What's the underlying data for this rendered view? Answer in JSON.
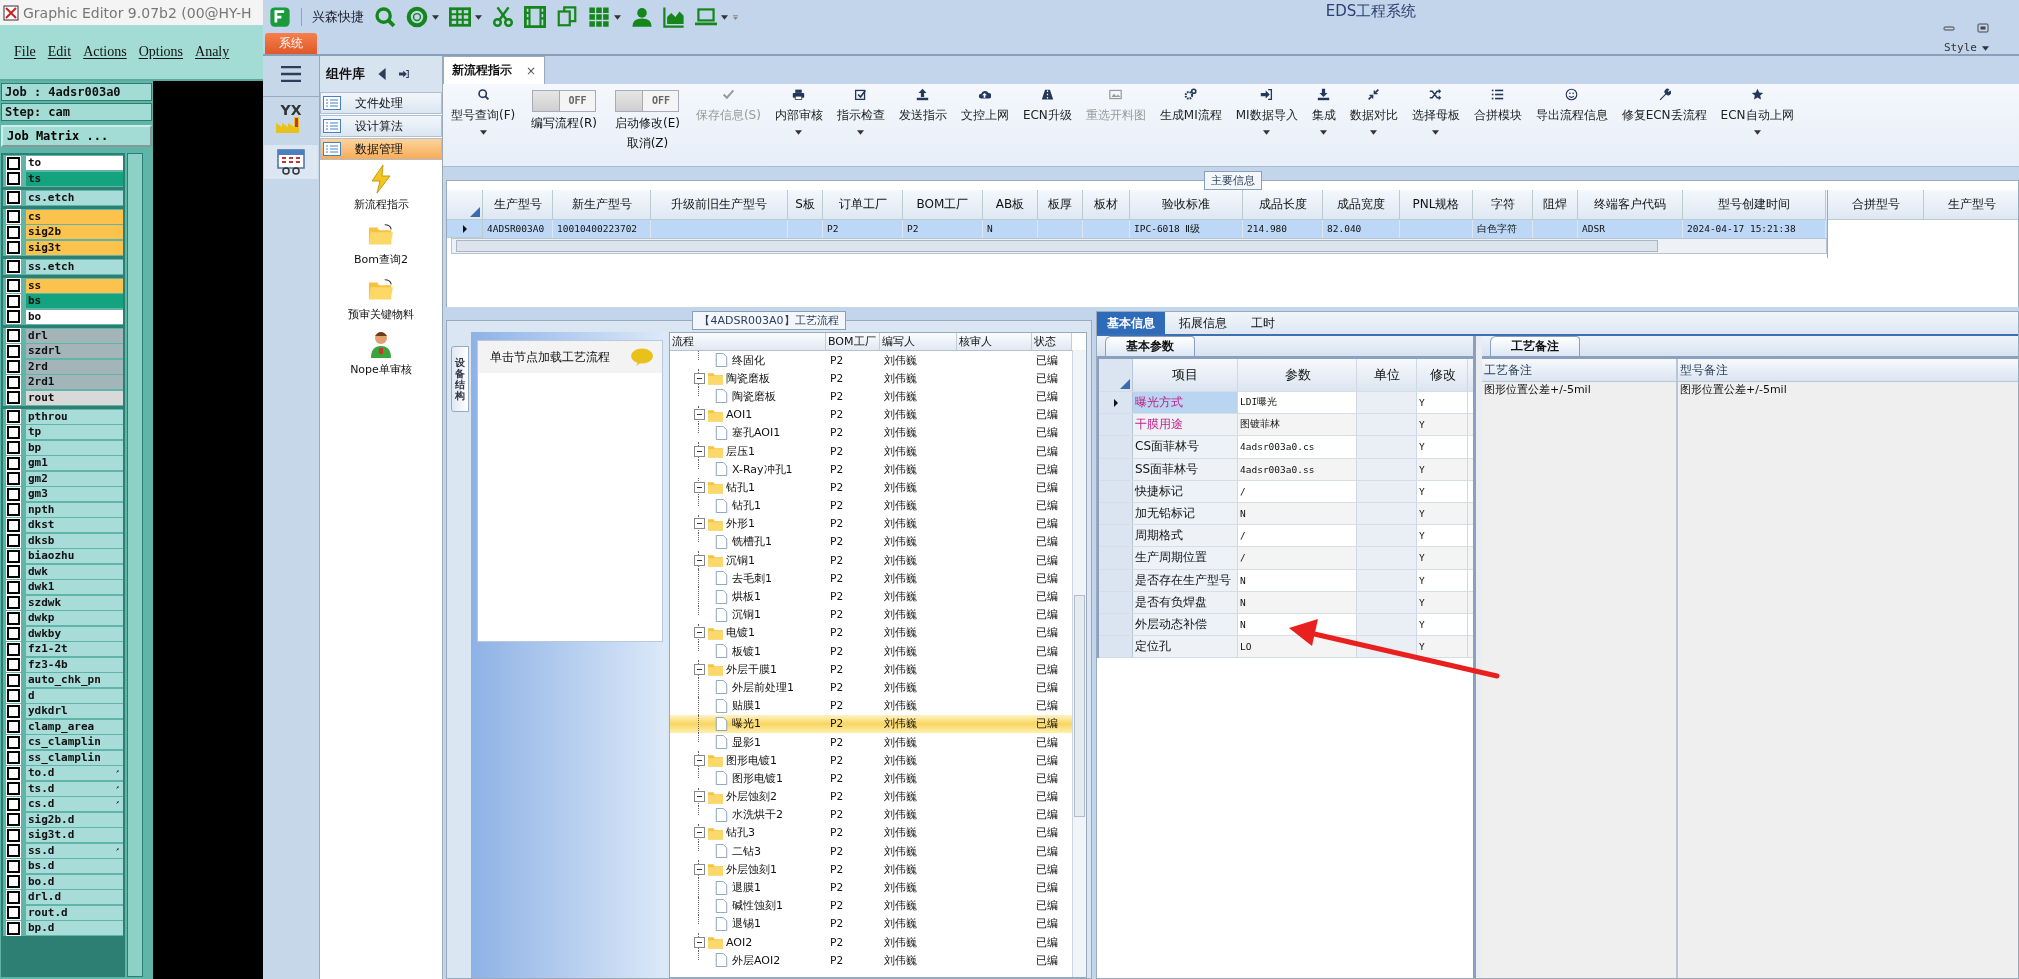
{
  "editor": {
    "title": "Graphic Editor 9.07b2 (00@HY-H",
    "menu": [
      "File",
      "Edit",
      "Actions",
      "Options",
      "Analy"
    ],
    "job": "Job : 4adsr003a0",
    "step": "Step: cam",
    "matrix_button": "Job Matrix ...",
    "layer_groups": [
      {
        "layers": [
          {
            "name": "to",
            "color": "#ffffff",
            "marked": false,
            "checked": false
          },
          {
            "name": "ts",
            "color": "#14a37f",
            "marked": false,
            "checked": false
          }
        ]
      },
      {
        "layers": [
          {
            "name": "cs.etch",
            "color": "#a7dcd8",
            "marked": false,
            "checked": false
          }
        ]
      },
      {
        "layers": [
          {
            "name": "cs",
            "color": "#fbc34e",
            "marked": false,
            "checked": false
          },
          {
            "name": "sig2b",
            "color": "#fbc34e",
            "marked": false,
            "checked": false
          },
          {
            "name": "sig3t",
            "color": "#fbc34e",
            "marked": false,
            "checked": false
          }
        ]
      },
      {
        "layers": [
          {
            "name": "ss.etch",
            "color": "#a7dcd8",
            "marked": false,
            "checked": false
          }
        ]
      },
      {
        "layers": [
          {
            "name": "ss",
            "color": "#fbc34e",
            "marked": false,
            "checked": false
          },
          {
            "name": "bs",
            "color": "#14a37f",
            "marked": false,
            "checked": false
          },
          {
            "name": "bo",
            "color": "#ffffff",
            "marked": false,
            "checked": false
          }
        ]
      },
      {
        "layers": [
          {
            "name": "drl",
            "color": "#a3b5b8",
            "marked": false,
            "checked": false
          },
          {
            "name": "szdrl",
            "color": "#a3b5b8",
            "marked": false,
            "checked": false
          },
          {
            "name": "2rd",
            "color": "#a3b5b8",
            "marked": false,
            "checked": false
          },
          {
            "name": "2rd1",
            "color": "#a3b5b8",
            "marked": false,
            "checked": false
          },
          {
            "name": "rout",
            "color": "#d9d9d9",
            "marked": false,
            "checked": false
          }
        ]
      },
      {
        "layers": [
          {
            "name": "pthrou",
            "color": "#a7dcd8",
            "marked": false,
            "checked": false
          },
          {
            "name": "tp",
            "color": "#a7dcd8",
            "marked": false,
            "checked": false
          },
          {
            "name": "bp",
            "color": "#a7dcd8",
            "marked": false,
            "checked": false
          },
          {
            "name": "gm1",
            "color": "#a7dcd8",
            "marked": false,
            "checked": false
          },
          {
            "name": "gm2",
            "color": "#a7dcd8",
            "marked": false,
            "checked": false
          },
          {
            "name": "gm3",
            "color": "#a7dcd8",
            "marked": false,
            "checked": false
          },
          {
            "name": "npth",
            "color": "#a7dcd8",
            "marked": false,
            "checked": false
          },
          {
            "name": "dkst",
            "color": "#a7dcd8",
            "marked": false,
            "checked": false
          },
          {
            "name": "dksb",
            "color": "#a7dcd8",
            "marked": false,
            "checked": false
          },
          {
            "name": "biaozhu",
            "color": "#a7dcd8",
            "marked": false,
            "checked": false
          },
          {
            "name": "dwk",
            "color": "#a7dcd8",
            "marked": false,
            "checked": false
          },
          {
            "name": "dwk1",
            "color": "#a7dcd8",
            "marked": false,
            "checked": false
          },
          {
            "name": "szdwk",
            "color": "#a7dcd8",
            "marked": false,
            "checked": false
          },
          {
            "name": "dwkp",
            "color": "#a7dcd8",
            "marked": false,
            "checked": false
          },
          {
            "name": "dwkby",
            "color": "#a7dcd8",
            "marked": false,
            "checked": false
          },
          {
            "name": "fz1-2t",
            "color": "#a7dcd8",
            "marked": false,
            "checked": false
          },
          {
            "name": "fz3-4b",
            "color": "#a7dcd8",
            "marked": false,
            "checked": false
          },
          {
            "name": "auto_chk_pn",
            "color": "#a7dcd8",
            "marked": false,
            "checked": false
          },
          {
            "name": "d",
            "color": "#a7dcd8",
            "marked": false,
            "checked": false
          },
          {
            "name": "ydkdrl",
            "color": "#a7dcd8",
            "marked": false,
            "checked": false
          },
          {
            "name": "clamp_area",
            "color": "#a7dcd8",
            "marked": false,
            "checked": false
          },
          {
            "name": "cs_clamplin",
            "color": "#a7dcd8",
            "marked": false,
            "checked": false
          },
          {
            "name": "ss_clamplin",
            "color": "#a7dcd8",
            "marked": false,
            "checked": false
          },
          {
            "name": "to.d",
            "color": "#a7dcd8",
            "marked": true,
            "checked": false
          },
          {
            "name": "ts.d",
            "color": "#a7dcd8",
            "marked": true,
            "checked": false
          },
          {
            "name": "cs.d",
            "color": "#a7dcd8",
            "marked": true,
            "checked": false
          },
          {
            "name": "sig2b.d",
            "color": "#a7dcd8",
            "marked": false,
            "checked": false
          },
          {
            "name": "sig3t.d",
            "color": "#a7dcd8",
            "marked": false,
            "checked": false
          },
          {
            "name": "ss.d",
            "color": "#a7dcd8",
            "marked": true,
            "checked": false
          },
          {
            "name": "bs.d",
            "color": "#a7dcd8",
            "marked": false,
            "checked": false
          },
          {
            "name": "bo.d",
            "color": "#a7dcd8",
            "marked": false,
            "checked": false
          },
          {
            "name": "drl.d",
            "color": "#a7dcd8",
            "marked": false,
            "checked": false
          },
          {
            "name": "rout.d",
            "color": "#a7dcd8",
            "marked": false,
            "checked": false
          },
          {
            "name": "bp.d",
            "color": "#a7dcd8",
            "marked": false,
            "checked": false
          }
        ]
      }
    ]
  },
  "eds": {
    "title": "EDS工程系统",
    "quick_label": "兴森快捷",
    "style_menu": "Style",
    "system_tab": "系统",
    "nav_logo": "YX",
    "library": {
      "title": "组件库",
      "categories": [
        {
          "label": "文件处理",
          "selected": false
        },
        {
          "label": "设计算法",
          "selected": false
        },
        {
          "label": "数据管理",
          "selected": true
        }
      ],
      "tools": [
        {
          "label": "新流程指示"
        },
        {
          "label": "Bom查询2"
        },
        {
          "label": "预审关键物料"
        },
        {
          "label": "Nope单审核"
        }
      ]
    },
    "doc_tab": {
      "label": "新流程指示",
      "close": "×"
    },
    "toolbar": [
      {
        "kind": "button",
        "label": "型号查询(F)",
        "dropdown": true,
        "disabled": false
      },
      {
        "kind": "toggle",
        "label": "编写流程(R)",
        "switch_text": "OFF",
        "on": false
      },
      {
        "kind": "toggle",
        "label": "启动修改(E)",
        "second_line": "取消(Z)",
        "switch_text": "OFF",
        "on": false
      },
      {
        "kind": "button",
        "label": "保存信息(S)",
        "dropdown": false,
        "disabled": true
      },
      {
        "kind": "button",
        "label": "内部审核",
        "dropdown": true,
        "disabled": false
      },
      {
        "kind": "button",
        "label": "指示检查",
        "dropdown": true,
        "disabled": false
      },
      {
        "kind": "button",
        "label": "发送指示",
        "dropdown": false,
        "disabled": false
      },
      {
        "kind": "button",
        "label": "文控上网",
        "dropdown": false,
        "disabled": false
      },
      {
        "kind": "button",
        "label": "ECN升级",
        "dropdown": false,
        "disabled": false
      },
      {
        "kind": "button",
        "label": "重选开料图",
        "dropdown": false,
        "disabled": true
      },
      {
        "kind": "button",
        "label": "生成MI流程",
        "dropdown": false,
        "disabled": false
      },
      {
        "kind": "button",
        "label": "MI数据导入",
        "dropdown": true,
        "disabled": false
      },
      {
        "kind": "button",
        "label": "集成",
        "dropdown": true,
        "disabled": false
      },
      {
        "kind": "button",
        "label": "数据对比",
        "dropdown": true,
        "disabled": false
      },
      {
        "kind": "button",
        "label": "选择母板",
        "dropdown": true,
        "disabled": false
      },
      {
        "kind": "button",
        "label": "合拼模块",
        "dropdown": false,
        "disabled": false
      },
      {
        "kind": "button",
        "label": "导出流程信息",
        "dropdown": false,
        "disabled": false
      },
      {
        "kind": "button",
        "label": "修复ECN丢流程",
        "dropdown": false,
        "disabled": false
      },
      {
        "kind": "button",
        "label": "ECN自动上网",
        "dropdown": true,
        "disabled": false
      }
    ],
    "main_info": {
      "legend": "主要信息",
      "columns": [
        "生产型号",
        "新生产型号",
        "升级前旧生产型号",
        "S板",
        "订单工厂",
        "BOM工厂",
        "AB板",
        "板厚",
        "板材",
        "验收标准",
        "成品长度",
        "成品宽度",
        "PNL规格",
        "字符",
        "阻焊",
        "终端客户代码",
        "型号创建时间"
      ],
      "rows": [
        {
          "selected": true,
          "cells": [
            "4ADSR003A0",
            "10010400223702",
            null,
            null,
            "P2",
            "P2",
            "N",
            null,
            null,
            "IPC-6018 Ⅱ级",
            "214.980",
            "82.040",
            null,
            "白色字符",
            null,
            "ADSR",
            "2024-04-17 15:21:38"
          ]
        }
      ],
      "side_columns": [
        "合拼型号",
        "生产型号"
      ]
    },
    "process": {
      "legend": "【4ADSR003A0】工艺流程",
      "side_tab": "设备结构",
      "hint": "单击节点加载工艺流程",
      "columns": [
        "流程",
        "BOM工厂",
        "编写人",
        "核审人",
        "状态"
      ],
      "tree": [
        {
          "children": [
            {
              "name": "终固化",
              "bom": "P2",
              "author": "刘伟巍",
              "status": "已编",
              "selected": false
            }
          ]
        },
        {
          "name": "陶瓷磨板",
          "bom": "P2",
          "author": "刘伟巍",
          "status": "已编",
          "selected": false,
          "expanded": true,
          "children": [
            {
              "name": "陶瓷磨板",
              "bom": "P2",
              "author": "刘伟巍",
              "status": "已编",
              "selected": false
            }
          ]
        },
        {
          "name": "AOI1",
          "bom": "P2",
          "author": "刘伟巍",
          "status": "已编",
          "selected": false,
          "expanded": true,
          "children": [
            {
              "name": "塞孔AOI1",
              "bom": "P2",
              "author": "刘伟巍",
              "status": "已编",
              "selected": false
            }
          ]
        },
        {
          "name": "层压1",
          "bom": "P2",
          "author": "刘伟巍",
          "status": "已编",
          "selected": false,
          "expanded": true,
          "children": [
            {
              "name": "X-Ray冲孔1",
              "bom": "P2",
              "author": "刘伟巍",
              "status": "已编",
              "selected": false
            }
          ]
        },
        {
          "name": "钻孔1",
          "bom": "P2",
          "author": "刘伟巍",
          "status": "已编",
          "selected": false,
          "expanded": true,
          "children": [
            {
              "name": "钻孔1",
              "bom": "P2",
              "author": "刘伟巍",
              "status": "已编",
              "selected": false
            }
          ]
        },
        {
          "name": "外形1",
          "bom": "P2",
          "author": "刘伟巍",
          "status": "已编",
          "selected": false,
          "expanded": true,
          "children": [
            {
              "name": "铣槽孔1",
              "bom": "P2",
              "author": "刘伟巍",
              "status": "已编",
              "selected": false
            }
          ]
        },
        {
          "name": "沉铜1",
          "bom": "P2",
          "author": "刘伟巍",
          "status": "已编",
          "selected": false,
          "expanded": true,
          "children": [
            {
              "name": "去毛刺1",
              "bom": "P2",
              "author": "刘伟巍",
              "status": "已编",
              "selected": false
            },
            {
              "name": "烘板1",
              "bom": "P2",
              "author": "刘伟巍",
              "status": "已编",
              "selected": false
            },
            {
              "name": "沉铜1",
              "bom": "P2",
              "author": "刘伟巍",
              "status": "已编",
              "selected": false
            }
          ]
        },
        {
          "name": "电镀1",
          "bom": "P2",
          "author": "刘伟巍",
          "status": "已编",
          "selected": false,
          "expanded": true,
          "children": [
            {
              "name": "板镀1",
              "bom": "P2",
              "author": "刘伟巍",
              "status": "已编",
              "selected": false
            }
          ]
        },
        {
          "name": "外层干膜1",
          "bom": "P2",
          "author": "刘伟巍",
          "status": "已编",
          "selected": false,
          "expanded": true,
          "children": [
            {
              "name": "外层前处理1",
              "bom": "P2",
              "author": "刘伟巍",
              "status": "已编",
              "selected": false
            },
            {
              "name": "贴膜1",
              "bom": "P2",
              "author": "刘伟巍",
              "status": "已编",
              "selected": false
            },
            {
              "name": "曝光1",
              "bom": "P2",
              "author": "刘伟巍",
              "status": "已编",
              "selected": true
            },
            {
              "name": "显影1",
              "bom": "P2",
              "author": "刘伟巍",
              "status": "已编",
              "selected": false
            }
          ]
        },
        {
          "name": "图形电镀1",
          "bom": "P2",
          "author": "刘伟巍",
          "status": "已编",
          "selected": false,
          "expanded": true,
          "children": [
            {
              "name": "图形电镀1",
              "bom": "P2",
              "author": "刘伟巍",
              "status": "已编",
              "selected": false
            }
          ]
        },
        {
          "name": "外层蚀刻2",
          "bom": "P2",
          "author": "刘伟巍",
          "status": "已编",
          "selected": false,
          "expanded": true,
          "children": [
            {
              "name": "水洗烘干2",
              "bom": "P2",
              "author": "刘伟巍",
              "status": "已编",
              "selected": false
            }
          ]
        },
        {
          "name": "钻孔3",
          "bom": "P2",
          "author": "刘伟巍",
          "status": "已编",
          "selected": false,
          "expanded": true,
          "children": [
            {
              "name": "二钻3",
              "bom": "P2",
              "author": "刘伟巍",
              "status": "已编",
              "selected": false
            }
          ]
        },
        {
          "name": "外层蚀刻1",
          "bom": "P2",
          "author": "刘伟巍",
          "status": "已编",
          "selected": false,
          "expanded": true,
          "children": [
            {
              "name": "退膜1",
              "bom": "P2",
              "author": "刘伟巍",
              "status": "已编",
              "selected": false
            },
            {
              "name": "碱性蚀刻1",
              "bom": "P2",
              "author": "刘伟巍",
              "status": "已编",
              "selected": false
            },
            {
              "name": "退锡1",
              "bom": "P2",
              "author": "刘伟巍",
              "status": "已编",
              "selected": false
            }
          ]
        },
        {
          "name": "AOI2",
          "bom": "P2",
          "author": "刘伟巍",
          "status": "已编",
          "selected": false,
          "expanded": true,
          "children": [
            {
              "name": "外层AOI2",
              "bom": "P2",
              "author": "刘伟巍",
              "status": "已编",
              "selected": false
            }
          ]
        }
      ]
    },
    "detail": {
      "tabs": [
        {
          "label": "基本信息",
          "selected": true
        },
        {
          "label": "拓展信息",
          "selected": false
        },
        {
          "label": "工时",
          "selected": false
        }
      ],
      "params": {
        "tab": "基本参数",
        "columns": [
          "项目",
          "参数",
          "单位",
          "修改"
        ],
        "rows": [
          {
            "item": "曝光方式",
            "value": "LDI曝光",
            "modify": "Y",
            "emphasis": true,
            "selected": true
          },
          {
            "item": "干膜用途",
            "value": "图镀菲林",
            "modify": "Y",
            "emphasis": true,
            "selected": false
          },
          {
            "item": "CS面菲林号",
            "value": "4adsr003a0.cs",
            "modify": "Y",
            "emphasis": false,
            "selected": false
          },
          {
            "item": "SS面菲林号",
            "value": "4adsr003a0.ss",
            "modify": "Y",
            "emphasis": false,
            "selected": false
          },
          {
            "item": "快捷标记",
            "value": "/",
            "modify": "Y",
            "emphasis": false,
            "selected": false
          },
          {
            "item": "加无铅标记",
            "value": "N",
            "modify": "Y",
            "emphasis": false,
            "selected": false
          },
          {
            "item": "周期格式",
            "value": "/",
            "modify": "Y",
            "emphasis": false,
            "selected": false
          },
          {
            "item": "生产周期位置",
            "value": "/",
            "modify": "Y",
            "emphasis": false,
            "selected": false
          },
          {
            "item": "是否存在生产型号",
            "value": "N",
            "modify": "Y",
            "emphasis": false,
            "selected": false
          },
          {
            "item": "是否有负焊盘",
            "value": "N",
            "modify": "Y",
            "emphasis": false,
            "selected": false
          },
          {
            "item": "外层动态补偿",
            "value": "N",
            "modify": "Y",
            "emphasis": false,
            "selected": false
          },
          {
            "item": "定位孔",
            "value": "LO",
            "modify": "Y",
            "emphasis": false,
            "selected": false
          }
        ]
      },
      "notes": {
        "tab": "工艺备注",
        "columns": [
          "工艺备注",
          "型号备注"
        ],
        "values": [
          "图形位置公差+/-5mil",
          "图形位置公差+/-5mil"
        ]
      }
    }
  }
}
